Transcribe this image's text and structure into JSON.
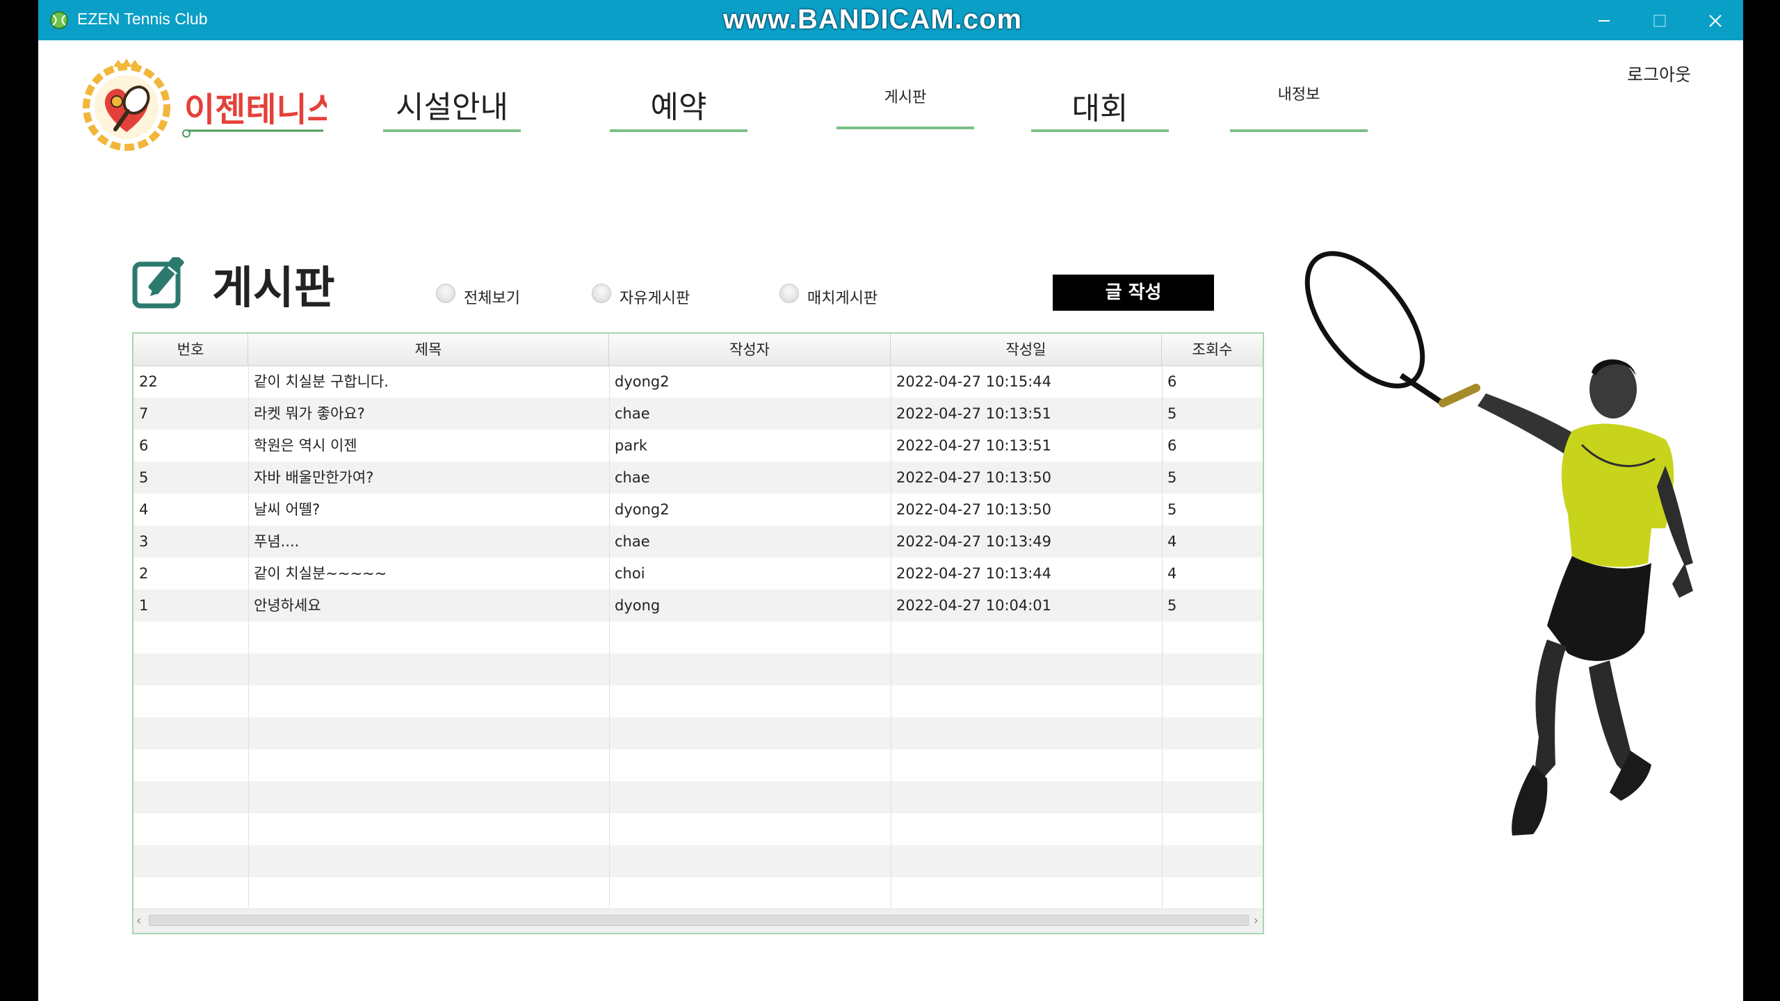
{
  "window": {
    "title": "EZEN Tennis Club",
    "watermark": "www.BANDICAM.com"
  },
  "logo": {
    "text": "이젠테니스"
  },
  "nav": {
    "items": [
      {
        "label": "시설안내"
      },
      {
        "label": "예약"
      },
      {
        "label": "게시판"
      },
      {
        "label": "대회"
      },
      {
        "label": "내정보"
      }
    ],
    "logout": "로그아웃"
  },
  "board": {
    "title": "게시판",
    "filters": [
      {
        "label": "전체보기"
      },
      {
        "label": "자유게시판"
      },
      {
        "label": "매치게시판"
      }
    ],
    "write_button": "글 작성",
    "columns": [
      "번호",
      "제목",
      "작성자",
      "작성일",
      "조회수"
    ],
    "rows": [
      [
        "22",
        "같이 치실분 구합니다.",
        "dyong2",
        "2022-04-27 10:15:44",
        "6"
      ],
      [
        "7",
        "라켓 뭐가 좋아요?",
        "chae",
        "2022-04-27 10:13:51",
        "5"
      ],
      [
        "6",
        "학원은 역시 이젠",
        "park",
        "2022-04-27 10:13:51",
        "6"
      ],
      [
        "5",
        "자바 배울만한가여?",
        "chae",
        "2022-04-27 10:13:50",
        "5"
      ],
      [
        "4",
        "날씨 어뗄?",
        "dyong2",
        "2022-04-27 10:13:50",
        "5"
      ],
      [
        "3",
        "푸념....",
        "chae",
        "2022-04-27 10:13:49",
        "4"
      ],
      [
        "2",
        "같이 치실분~~~~~",
        "choi",
        "2022-04-27 10:13:44",
        "4"
      ],
      [
        "1",
        "안녕하세요",
        "dyong",
        "2022-04-27 10:04:01",
        "5"
      ]
    ]
  },
  "colors": {
    "titlebar": "#0a9fc6",
    "nav_underline": "#7cbf86",
    "table_border": "#a9d6ae",
    "logo_gold": "#f2b63a",
    "logo_red": "#e4403a",
    "player_shirt": "#c8d41c"
  }
}
